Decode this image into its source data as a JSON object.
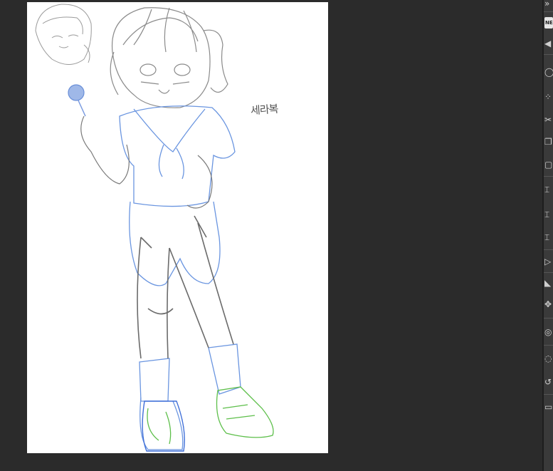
{
  "app": {
    "background_color": "#2b2b2b",
    "canvas_color": "#ffffff"
  },
  "canvas": {
    "handwritten_note": "세라복"
  },
  "toolbar": {
    "tools": [
      {
        "icon": "collapse-icon",
        "glyph": "»"
      },
      {
        "icon": "new-badge-icon",
        "glyph": "NE"
      },
      {
        "icon": "undo-arrow-icon",
        "glyph": "◀"
      },
      {
        "icon": "lasso-icon",
        "glyph": "◯"
      },
      {
        "icon": "magic-wand-icon",
        "glyph": "⁘"
      },
      {
        "icon": "cut-icon",
        "glyph": "✂"
      },
      {
        "icon": "copy-icon",
        "glyph": "❐"
      },
      {
        "icon": "paste-icon",
        "glyph": "▢"
      },
      {
        "icon": "crop-icon",
        "glyph": "⌶"
      },
      {
        "icon": "transform-icon",
        "glyph": "⌶"
      },
      {
        "icon": "scale-icon",
        "glyph": "⌶"
      },
      {
        "icon": "play-icon",
        "glyph": "▷"
      },
      {
        "icon": "flip-icon",
        "glyph": "◣"
      },
      {
        "icon": "move-icon",
        "glyph": "✥"
      },
      {
        "icon": "fill-icon",
        "glyph": "◎"
      },
      {
        "icon": "clear-icon",
        "glyph": "◌"
      },
      {
        "icon": "rotate-icon",
        "glyph": "↺"
      },
      {
        "icon": "settings-icon",
        "glyph": "▭"
      }
    ]
  }
}
